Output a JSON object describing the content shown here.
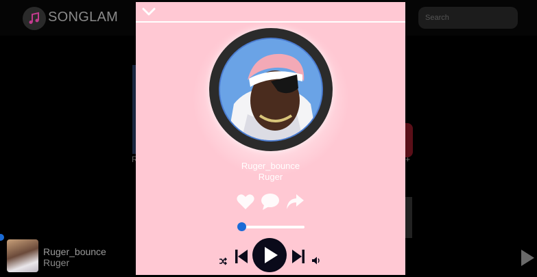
{
  "app": {
    "name": "SONGLAM",
    "search_placeholder": "Search"
  },
  "background": {
    "card_left_caption": "R",
    "card_right_caption": "+"
  },
  "now_playing": {
    "title": "Ruger_bounce",
    "artist": "Ruger"
  },
  "player": {
    "title": "Ruger_bounce",
    "artist": "Ruger",
    "progress": 0.04,
    "icons": {
      "collapse": "chevron-down-icon",
      "like": "heart-icon",
      "comment": "comment-icon",
      "share": "share-icon",
      "shuffle": "shuffle-icon",
      "previous": "skip-previous-icon",
      "play": "play-icon",
      "next": "skip-next-icon",
      "volume": "volume-icon"
    }
  },
  "colors": {
    "modal_background": "#ffc8d3",
    "accent": "#1a6bd6",
    "disc": "#2b2b2b",
    "play_button": "#0a0a1a"
  }
}
